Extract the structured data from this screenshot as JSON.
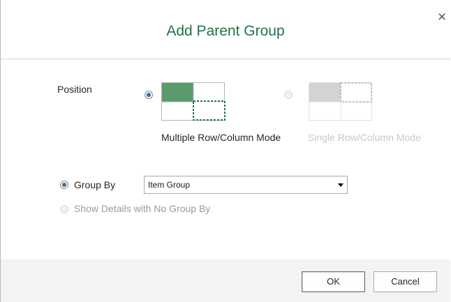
{
  "dialog": {
    "title": "Add Parent Group",
    "close_icon": "close-icon"
  },
  "position": {
    "label": "Position",
    "modes": [
      {
        "label": "Multiple Row/Column Mode",
        "selected": true,
        "enabled": true,
        "icon": "multiple-row-column-mode-icon"
      },
      {
        "label": "Single Row/Column Mode",
        "selected": false,
        "enabled": false,
        "icon": "single-row-column-mode-icon"
      }
    ]
  },
  "grouping": {
    "group_by_label": "Group By",
    "group_by_selected": true,
    "group_by_value": "Item Group",
    "no_group_label": "Show Details with No Group By",
    "no_group_selected": false,
    "no_group_enabled": false
  },
  "buttons": {
    "ok": "OK",
    "cancel": "Cancel"
  },
  "colors": {
    "title": "#217346",
    "accent_fill": "#5b9b6b",
    "accent_dashed": "#217346",
    "disabled_fill": "#d3d3d3"
  }
}
